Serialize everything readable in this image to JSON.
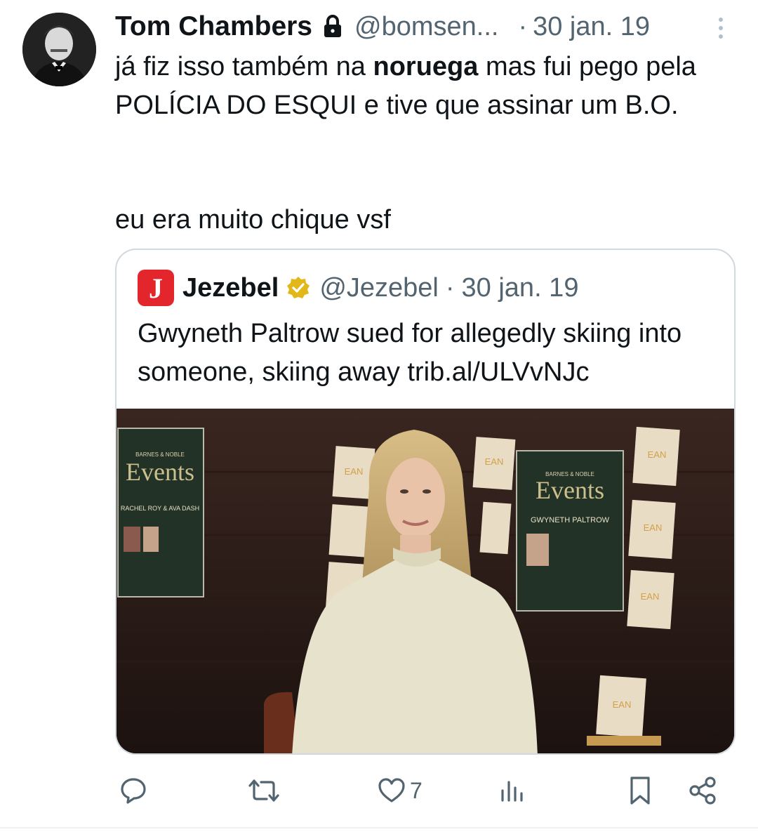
{
  "tweet": {
    "author_name": "Tom Chambers",
    "author_handle": "@bomsen...",
    "separator": "·",
    "date": "30 jan. 19",
    "line1_pre": "já fiz isso também na ",
    "line1_bold": "noruega",
    "line1_post": " mas fui pego pela POLÍCIA DO ESQUI e tive que assinar um B.O.",
    "line2": "eu era muito chique vsf"
  },
  "quote": {
    "logo_letter": "J",
    "name": "Jezebel",
    "handle": "@Jezebel",
    "separator": "·",
    "date": "30 jan. 19",
    "text": "Gwyneth Paltrow sued for allegedly skiing into someone, skiing away trib.al/ULVvNJc",
    "image": {
      "left_sign_brand": "BARNES & NOBLE",
      "left_sign_title": "Events",
      "left_sign_sub": "RACHEL ROY & AVA DASH",
      "center_sign_brand": "BARNES & NOBLE",
      "center_sign_title": "Events",
      "center_sign_sub": "GWYNETH PALTROW",
      "book_word": "EAN"
    }
  },
  "actions": {
    "like_count": "7"
  },
  "colors": {
    "text": "#0f1419",
    "muted": "#536471",
    "border": "#cfd9de",
    "jezebel_red": "#e3252c",
    "verified_gold": "#e2b719"
  }
}
